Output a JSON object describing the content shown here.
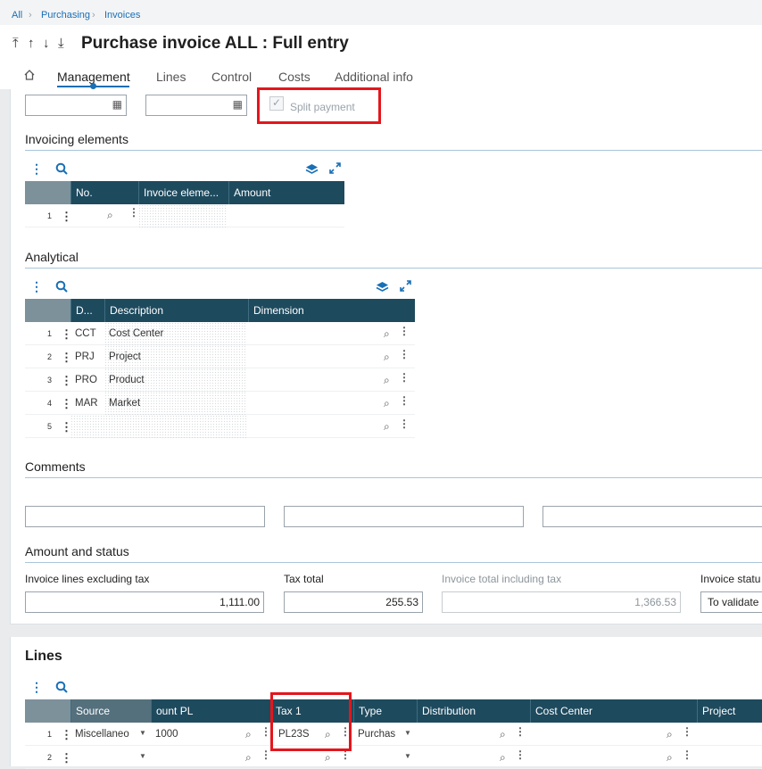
{
  "breadcrumb": {
    "items": [
      "All",
      "Purchasing",
      "Invoices"
    ]
  },
  "header": {
    "nav_icons": [
      "⤒",
      "↑",
      "↓",
      "⤓"
    ],
    "title": "Purchase invoice ALL : Full entry",
    "tabs": [
      "Management",
      "Lines",
      "Control",
      "Costs",
      "Additional info"
    ],
    "active_tab": "Management"
  },
  "top_fields": {
    "split_payment_label": "Split payment",
    "split_payment_checked": true
  },
  "invoicing_elements": {
    "title": "Invoicing elements",
    "columns": [
      "No.",
      "Invoice eleme...",
      "Amount"
    ],
    "rows": [
      {
        "num": "1"
      }
    ]
  },
  "analytical": {
    "title": "Analytical",
    "columns": [
      "D...",
      "Description",
      "Dimension"
    ],
    "rows": [
      {
        "num": "1",
        "code": "CCT",
        "description": "Cost Center"
      },
      {
        "num": "2",
        "code": "PRJ",
        "description": "Project"
      },
      {
        "num": "3",
        "code": "PRO",
        "description": "Product"
      },
      {
        "num": "4",
        "code": "MAR",
        "description": "Market"
      },
      {
        "num": "5",
        "code": "",
        "description": ""
      }
    ]
  },
  "comments": {
    "title": "Comments"
  },
  "amount_status": {
    "title": "Amount and status",
    "lines_excl_tax_label": "Invoice lines excluding tax",
    "lines_excl_tax_value": "1,111.00",
    "tax_total_label": "Tax total",
    "tax_total_value": "255.53",
    "total_incl_tax_label": "Invoice total including tax",
    "total_incl_tax_value": "1,366.53",
    "status_label": "Invoice statu",
    "status_value": "To validate"
  },
  "lines": {
    "title": "Lines",
    "columns": [
      "Source",
      "ount PL",
      "Tax 1",
      "Type",
      "Distribution",
      "Cost Center",
      "Project"
    ],
    "rows": [
      {
        "num": "1",
        "source": "Miscellaneo",
        "account": "1000",
        "tax": "PL23S",
        "type": "Purchas"
      },
      {
        "num": "2",
        "source": "",
        "account": "",
        "tax": "",
        "type": ""
      }
    ]
  },
  "colors": {
    "accent": "#1a6fb5",
    "header_bg": "#1e4a5e",
    "highlight": "#e3161c"
  }
}
